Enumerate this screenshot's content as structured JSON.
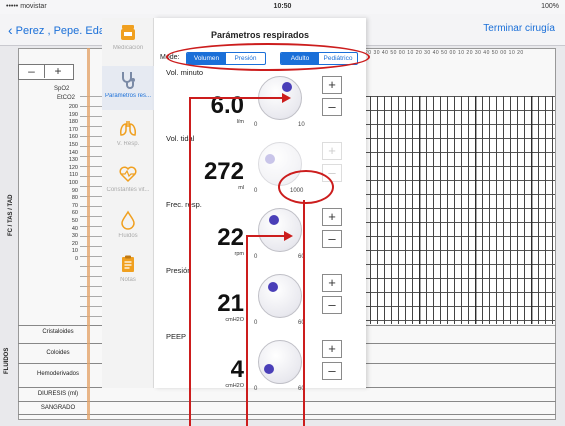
{
  "status_bar": {
    "carrier": "••••• movistar",
    "time": "10:50",
    "battery": "100%"
  },
  "nav": {
    "back_label": "Perez , Pepe. Eda",
    "right_action": "Terminar cirugía"
  },
  "background": {
    "stepper_minus": "–",
    "stepper_plus": "+",
    "time_ticks": "20 30 40 50 00 10 20 30 40 50 00 10 20 30 40 50 00 10 20",
    "spo2_label": "SpO2",
    "etco2_label": "EtCO2",
    "y_axis_ticks": [
      "200",
      "190",
      "180",
      "170",
      "160",
      "150",
      "140",
      "130",
      "120",
      "110",
      "100",
      "90",
      "80",
      "70",
      "60",
      "50",
      "40",
      "30",
      "20",
      "10",
      "0"
    ],
    "y_axis_title": "FC / TAS / TAD",
    "fluids_title": "FLUIDOS",
    "fluid_rows": [
      "Cristaloides",
      "Coloides",
      "Hemoderivados",
      "DIURESIS (ml)",
      "SANGRADO"
    ]
  },
  "sidebar": {
    "items": [
      {
        "label": "Medicación",
        "icon": "medication-icon"
      },
      {
        "label": "Parámetros res...",
        "icon": "stethoscope-icon"
      },
      {
        "label": "V. Resp.",
        "icon": "lungs-icon"
      },
      {
        "label": "Constantes vit...",
        "icon": "heart-pulse-icon"
      },
      {
        "label": "Fluidos",
        "icon": "drop-icon"
      },
      {
        "label": "Notas",
        "icon": "clipboard-icon"
      }
    ]
  },
  "panel": {
    "title": "Parámetros respirados",
    "mode_label": "Mode:",
    "mode_options": [
      "Volumen",
      "Presión"
    ],
    "patient_options": [
      "Adulto",
      "Pediátrico"
    ],
    "params": [
      {
        "label": "Vol. minuto",
        "value": "6.0",
        "unit": "l/m",
        "min": "0",
        "max": "10",
        "enabled": true,
        "fraction": 0.6
      },
      {
        "label": "Vol. tidal",
        "value": "272",
        "unit": "ml",
        "min": "0",
        "max": "1000",
        "enabled": false,
        "fraction": 0.27
      },
      {
        "label": "Frec. resp.",
        "value": "22",
        "unit": "rpm",
        "min": "0",
        "max": "60",
        "enabled": true,
        "fraction": 0.37
      },
      {
        "label": "Presión",
        "value": "21",
        "unit": "cmH2O",
        "min": "0",
        "max": "60",
        "enabled": true,
        "fraction": 0.35
      },
      {
        "label": "PEEP",
        "value": "4",
        "unit": "cmH2O",
        "min": "0",
        "max": "60",
        "enabled": true,
        "fraction": 0.07
      }
    ],
    "plus": "+",
    "minus": "–"
  },
  "colors": {
    "accent": "#1a6fd8",
    "knob": "#4a3fb8",
    "annotation": "#cc1d1d",
    "timeline": "#e4a46a"
  }
}
